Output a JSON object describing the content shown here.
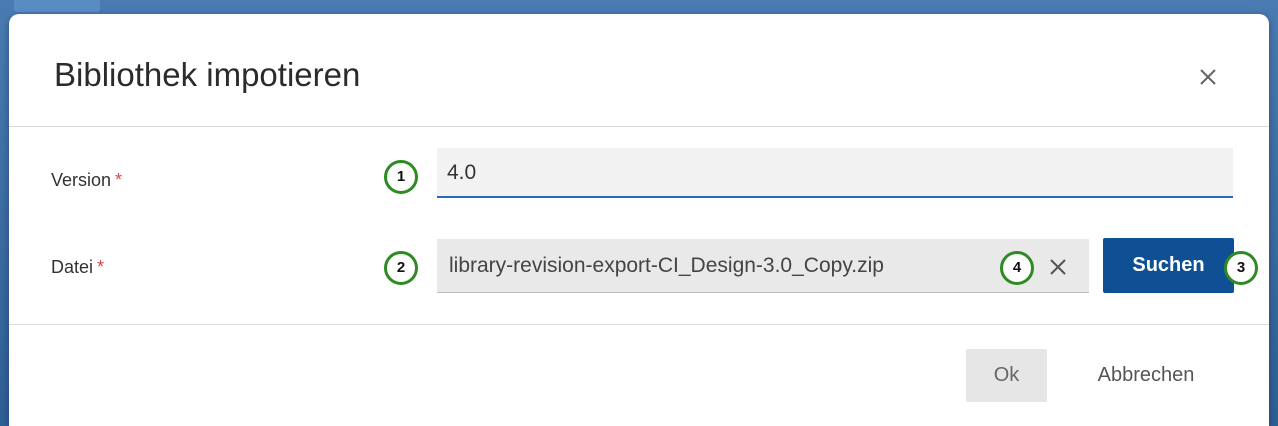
{
  "dialog": {
    "title": "Bibliothek impotieren"
  },
  "form": {
    "version_label": "Version",
    "version_required": "*",
    "version_value": "4.0",
    "file_label": "Datei",
    "file_required": "*",
    "file_value": "library-revision-export-CI_Design-3.0_Copy.zip",
    "search_label": "Suchen"
  },
  "footer": {
    "ok_label": "Ok",
    "cancel_label": "Abbrechen"
  },
  "markers": [
    "1",
    "2",
    "3",
    "4"
  ],
  "icons": {
    "close": "close-icon",
    "clear": "clear-icon"
  },
  "colors": {
    "primary": "#0f4f94",
    "underline": "#2a6ab5",
    "required": "#d64545",
    "marker": "#2e8b22"
  }
}
